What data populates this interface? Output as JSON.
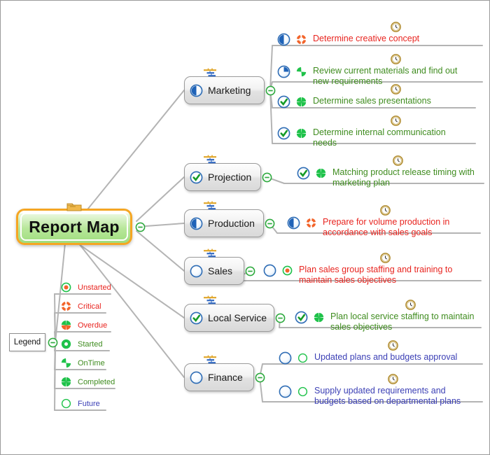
{
  "meta": {
    "title": "Report Map",
    "colors": {
      "red": "#e8241f",
      "green": "#3f8c1f",
      "blue": "#3b3fb5",
      "orange_accent": "#f5a623",
      "line": "#b4b4b4",
      "icon_green": "#1fc24a",
      "icon_orange": "#f2642a"
    }
  },
  "root": {
    "label": "Report Map",
    "icon": "folder-icon",
    "collapse": "collapse-minus-icon"
  },
  "legend": {
    "label": "Legend",
    "collapse": "collapse-minus-icon",
    "items": [
      {
        "label": "Unstarted",
        "icon": "status-unstarted-icon",
        "color": "#e8241f"
      },
      {
        "label": "Critical",
        "icon": "status-critical-icon",
        "color": "#e8241f"
      },
      {
        "label": "Overdue",
        "icon": "status-overdue-icon",
        "color": "#e8241f"
      },
      {
        "label": "Started",
        "icon": "status-started-icon",
        "color": "#3f8c1f"
      },
      {
        "label": "OnTime",
        "icon": "status-ontime-icon",
        "color": "#3f8c1f"
      },
      {
        "label": "Completed",
        "icon": "status-completed-icon",
        "color": "#3f8c1f"
      },
      {
        "label": "Future",
        "icon": "status-future-icon",
        "color": "#3b3fb5"
      }
    ]
  },
  "branches": [
    {
      "label": "Marketing",
      "progress": "progress-50-icon",
      "taskinfo": "task-info-icon",
      "collapse": "collapse-minus-icon",
      "topics": [
        {
          "text": "Determine creative concept",
          "color": "#e8241f",
          "progress": "progress-50-icon",
          "status": "status-critical-icon",
          "clock": "clock-icon"
        },
        {
          "text": "Review current materials and find out\nnew requirements",
          "color": "#3f8c1f",
          "progress": "progress-75-icon",
          "status": "status-ontime-icon",
          "clock": "clock-icon"
        },
        {
          "text": "Determine sales presentations",
          "color": "#3f8c1f",
          "progress": "progress-100-icon",
          "status": "status-completed-icon",
          "clock": "clock-icon"
        },
        {
          "text": "Determine internal communication\nneeds",
          "color": "#3f8c1f",
          "progress": "progress-100-icon",
          "status": "status-completed-icon",
          "clock": "clock-icon"
        }
      ]
    },
    {
      "label": "Projection",
      "progress": "progress-100-icon",
      "taskinfo": "task-info-icon",
      "collapse": "collapse-minus-icon",
      "topics": [
        {
          "text": "Matching product release timing with\nmarketing plan",
          "color": "#3f8c1f",
          "progress": "progress-100-icon",
          "status": "status-completed-icon",
          "clock": "clock-icon"
        }
      ]
    },
    {
      "label": "Production",
      "progress": "progress-50-icon",
      "taskinfo": "task-info-icon",
      "collapse": "collapse-minus-icon",
      "topics": [
        {
          "text": "Prepare for volume production in\naccordance with sales goals",
          "color": "#e8241f",
          "progress": "progress-50-icon",
          "status": "status-critical-icon",
          "clock": "clock-icon"
        }
      ]
    },
    {
      "label": "Sales",
      "progress": "progress-0-icon",
      "taskinfo": "task-info-icon",
      "collapse": "collapse-minus-icon",
      "topics": [
        {
          "text": "Plan sales group staffing and training to\nmaintain sales objectives",
          "color": "#e8241f",
          "progress": "progress-0-icon",
          "status": "status-unstarted-icon",
          "clock": "clock-icon"
        }
      ]
    },
    {
      "label": "Local Service",
      "progress": "progress-100-icon",
      "taskinfo": "task-info-icon",
      "collapse": "collapse-minus-icon",
      "topics": [
        {
          "text": "Plan local service staffing to maintain\nsales objectives",
          "color": "#3f8c1f",
          "progress": "progress-100-icon",
          "status": "status-completed-icon",
          "clock": "clock-icon"
        }
      ]
    },
    {
      "label": "Finance",
      "progress": "progress-0-icon",
      "taskinfo": "task-info-icon",
      "collapse": "collapse-minus-icon",
      "topics": [
        {
          "text": "Updated plans and budgets approval",
          "color": "#3b3fb5",
          "progress": "progress-0-icon",
          "status": "status-future-icon",
          "clock": "clock-icon"
        },
        {
          "text": "Supply updated requirements and\nbudgets based on departmental plans",
          "color": "#3b3fb5",
          "progress": "progress-0-icon",
          "status": "status-future-icon",
          "clock": "clock-icon"
        }
      ]
    }
  ]
}
